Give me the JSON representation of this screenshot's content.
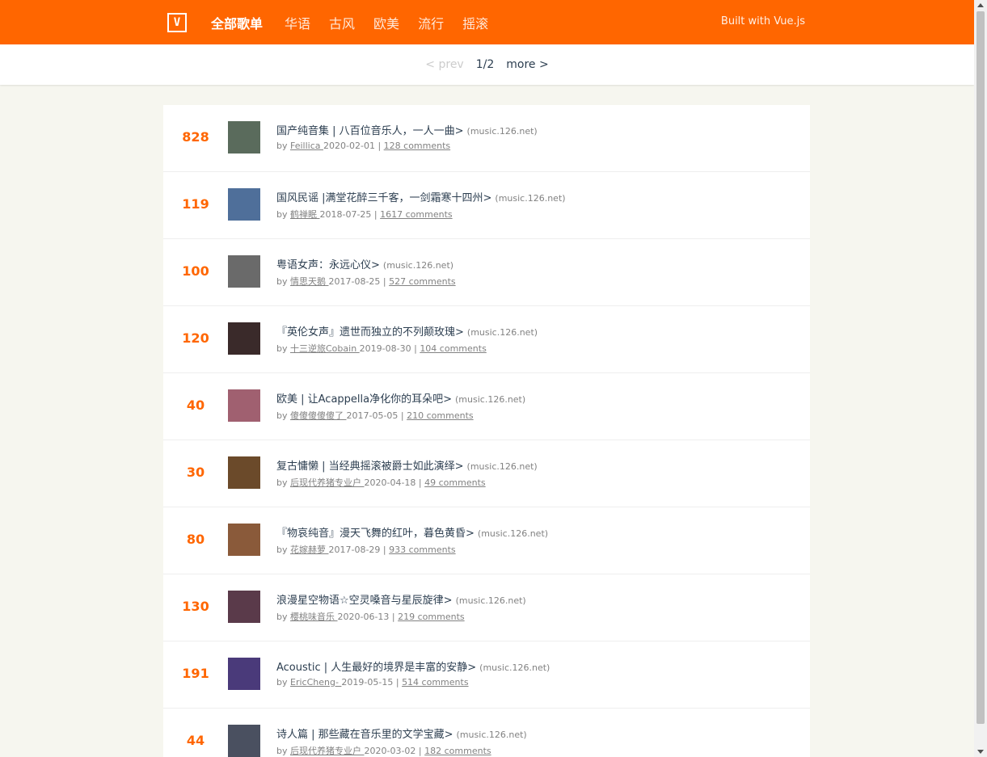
{
  "header": {
    "logo": "V",
    "nav": [
      "全部歌单",
      "华语",
      "古风",
      "欧美",
      "流行",
      "摇滚"
    ],
    "built_with": "Built with Vue.js"
  },
  "pager": {
    "prev": "< prev",
    "count": "1/2",
    "more": "more >"
  },
  "items": [
    {
      "score": "828",
      "title": "国产纯音集 | 八百位音乐人，一人一曲>",
      "host": "(music.126.net)",
      "by": "by",
      "author": "Feillica ",
      "date": "2020-02-01 |",
      "comments": "128 comments",
      "thumb_color": "#5a6b5c"
    },
    {
      "score": "119",
      "title": "国风民谣 |满堂花醉三千客，一剑霜寒十四州>",
      "host": "(music.126.net)",
      "by": "by",
      "author": "鹤禅眠 ",
      "date": "2018-07-25 |",
      "comments": "1617 comments",
      "thumb_color": "#4f6f9a"
    },
    {
      "score": "100",
      "title": "粤语女声：永远心仪>",
      "host": "(music.126.net)",
      "by": "by",
      "author": "情思天鹅 ",
      "date": "2017-08-25 |",
      "comments": "527 comments",
      "thumb_color": "#6a6a6a"
    },
    {
      "score": "120",
      "title": "『英伦女声』遗世而独立的不列颠玫瑰>",
      "host": "(music.126.net)",
      "by": "by",
      "author": "十三逆旅Cobain ",
      "date": "2019-08-30 |",
      "comments": "104 comments",
      "thumb_color": "#3a2a2a"
    },
    {
      "score": "40",
      "title": "欧美 | 让Acappella净化你的耳朵吧>",
      "host": "(music.126.net)",
      "by": "by",
      "author": "傻傻傻傻傻了 ",
      "date": "2017-05-05 |",
      "comments": "210 comments",
      "thumb_color": "#a06070"
    },
    {
      "score": "30",
      "title": "复古慵懒 | 当经典摇滚被爵士如此演绎>",
      "host": "(music.126.net)",
      "by": "by",
      "author": "后现代养猪专业户 ",
      "date": "2020-04-18 |",
      "comments": "49 comments",
      "thumb_color": "#6b4a2a"
    },
    {
      "score": "80",
      "title": "『物哀纯音』漫天飞舞的红叶，暮色黄昏>",
      "host": "(music.126.net)",
      "by": "by",
      "author": "花嫁赫萝 ",
      "date": "2017-08-29 |",
      "comments": "933 comments",
      "thumb_color": "#8a5a3a"
    },
    {
      "score": "130",
      "title": "浪漫星空物语☆空灵嗓音与星辰旋律>",
      "host": "(music.126.net)",
      "by": "by",
      "author": "樱桃味音乐 ",
      "date": "2020-06-13 |",
      "comments": "219 comments",
      "thumb_color": "#5a3a4a"
    },
    {
      "score": "191",
      "title": "Acoustic | 人生最好的境界是丰富的安静>",
      "host": "(music.126.net)",
      "by": "by",
      "author": "EricCheng- ",
      "date": "2019-05-15 |",
      "comments": "514 comments",
      "thumb_color": "#4a3a7a"
    },
    {
      "score": "44",
      "title": "诗人篇 | 那些藏在音乐里的文学宝藏>",
      "host": "(music.126.net)",
      "by": "by",
      "author": "后现代养猪专业户 ",
      "date": "2020-03-02 |",
      "comments": "182 comments",
      "thumb_color": "#4a5060"
    }
  ]
}
